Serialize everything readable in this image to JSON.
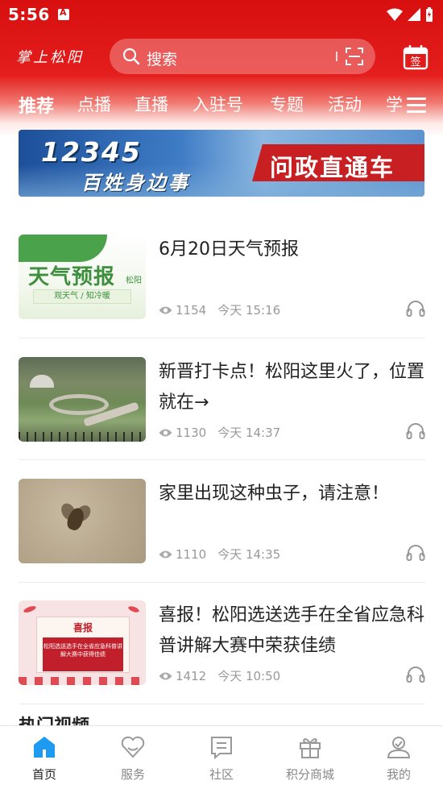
{
  "status_bar": {
    "time": "5:56"
  },
  "header": {
    "logo": "掌上松阳",
    "search_placeholder": "搜索",
    "sign_label": "签"
  },
  "tabs": [
    {
      "label": "推荐",
      "active": true
    },
    {
      "label": "点播",
      "active": false
    },
    {
      "label": "直播",
      "active": false
    },
    {
      "label": "入驻号",
      "active": false
    },
    {
      "label": "专题",
      "active": false
    },
    {
      "label": "活动",
      "active": false
    },
    {
      "label": "学",
      "active": false
    }
  ],
  "banner": {
    "number": "12345",
    "subtitle": "百姓身边事",
    "label": "问政直通车"
  },
  "news": [
    {
      "title": "6月20日天气预报",
      "views": "1154",
      "time": "今天 15:16",
      "thumb": {
        "title": "天气预报",
        "place": "松阳",
        "tagline": "观天气 / 知冷暖"
      }
    },
    {
      "title": "新晋打卡点！松阳这里火了，位置就在→",
      "views": "1130",
      "time": "今天 14:37"
    },
    {
      "title": "家里出现这种虫子，请注意！",
      "views": "1110",
      "time": "今天 14:35"
    },
    {
      "title": "喜报！松阳选送选手在全省应急科普讲解大赛中荣获佳绩",
      "views": "1412",
      "time": "今天 10:50",
      "thumb": {
        "head": "喜报",
        "body": "松阳选送选手在全省应急科普讲解大赛中获得佳绩"
      }
    }
  ],
  "section_partial": "热门视频",
  "bottom_nav": [
    {
      "label": "首页",
      "active": true
    },
    {
      "label": "服务",
      "active": false
    },
    {
      "label": "社区",
      "active": false
    },
    {
      "label": "积分商城",
      "active": false
    },
    {
      "label": "我的",
      "active": false
    }
  ],
  "colors": {
    "brand_red": "#d7100f",
    "active_tab_blue": "#1e9bf0",
    "meta_gray": "#999999"
  }
}
